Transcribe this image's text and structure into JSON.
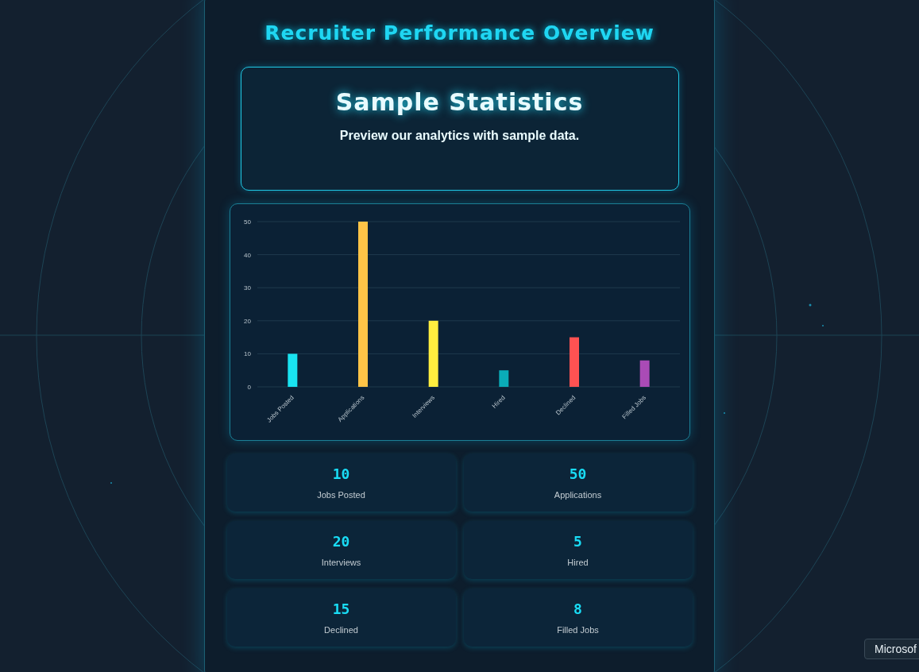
{
  "title": "Recruiter Performance Overview",
  "hero": {
    "heading": "Sample Statistics",
    "subtitle": "Preview our analytics with sample data."
  },
  "chart": {
    "chart_data": {
      "type": "bar",
      "categories": [
        "Jobs Posted",
        "Applications",
        "Interviews",
        "Hired",
        "Declined",
        "Filled Jobs"
      ],
      "values": [
        10,
        50,
        20,
        5,
        15,
        8
      ],
      "ylim": [
        0,
        50
      ],
      "yticks": [
        0,
        10,
        20,
        30,
        40,
        50
      ],
      "grid": true
    },
    "bars": [
      {
        "color": "#19e3f0"
      },
      {
        "color": "#ffc447"
      },
      {
        "color": "#ffee3f"
      },
      {
        "color": "#0aacb8"
      },
      {
        "color": "#ff5252"
      },
      {
        "color": "#aa4bb6"
      }
    ]
  },
  "stats": [
    {
      "value": "10",
      "label": "Jobs Posted"
    },
    {
      "value": "50",
      "label": "Applications"
    },
    {
      "value": "20",
      "label": "Interviews"
    },
    {
      "value": "5",
      "label": "Hired"
    },
    {
      "value": "15",
      "label": "Declined"
    },
    {
      "value": "8",
      "label": "Filled Jobs"
    }
  ],
  "tooltip": {
    "text": "Microsof"
  }
}
